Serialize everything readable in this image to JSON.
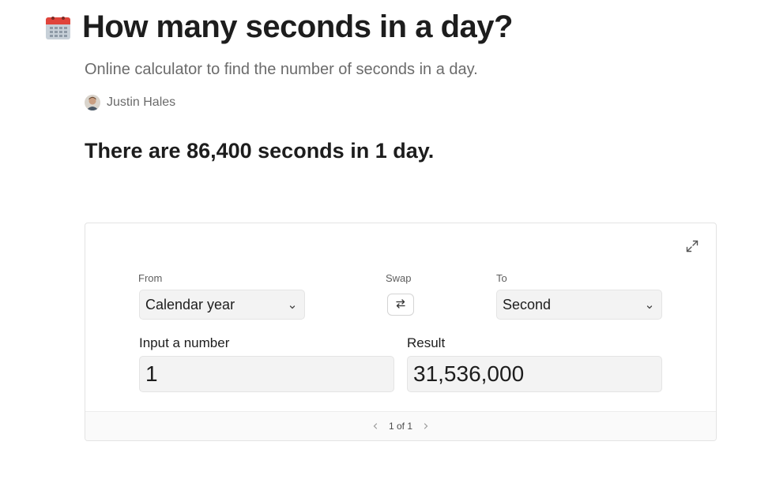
{
  "header": {
    "icon": "calendar-icon",
    "title": "How many seconds in a day?",
    "subtitle": "Online calculator to find the number of seconds in a day."
  },
  "author": {
    "name": "Justin Hales",
    "avatar_icon": "avatar"
  },
  "answer": "There are 86,400 seconds in 1 day.",
  "calculator": {
    "expand_icon": "expand-icon",
    "from": {
      "label": "From",
      "value": "Calendar year"
    },
    "swap": {
      "label": "Swap",
      "icon": "swap-arrows-icon"
    },
    "to": {
      "label": "To",
      "value": "Second"
    },
    "input": {
      "label": "Input a number",
      "value": "1"
    },
    "result": {
      "label": "Result",
      "value": "31,536,000"
    },
    "pager": {
      "text": "1 of 1",
      "prev_icon": "chevron-left-icon",
      "next_icon": "chevron-right-icon"
    }
  },
  "colors": {
    "calendar_red": "#e0443b",
    "calendar_body": "#b9c3cc",
    "text_primary": "#1d1d1d",
    "text_muted": "#6b6b6b"
  }
}
